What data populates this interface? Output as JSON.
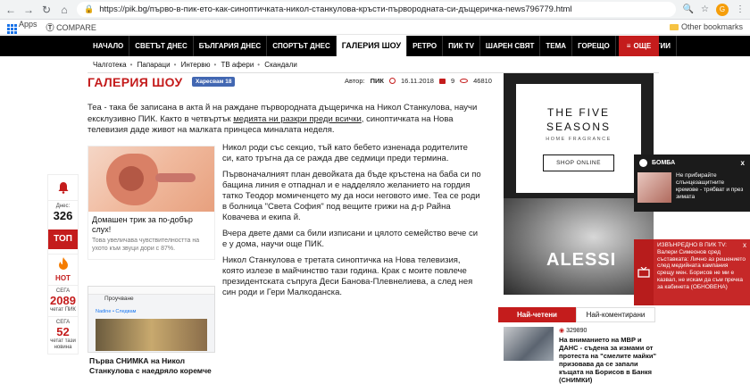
{
  "browser": {
    "url": "https://pik.bg/първо-в-пик-ето-как-синоптичката-никол-станкулова-кръсти-първородната-си-дъщеричка-news796779.html",
    "ext_badge": "G",
    "bookmarks": {
      "apps": "Apps",
      "compare": "COMPARE",
      "other": "Other bookmarks"
    }
  },
  "nav": {
    "items": [
      "НАЧАЛО",
      "СВЕТЪТ ДНЕС",
      "БЪЛГАРИЯ ДНЕС",
      "СПОРТЪТ ДНЕС",
      "ГАЛЕРИЯ ШОУ",
      "РЕТРО",
      "ПИК TV",
      "ШАРЕН СВЯТ",
      "ТЕМА",
      "ГОРЕЩО",
      "ТЕХНОЛОГИИ"
    ],
    "active": "ГАЛЕРИЯ ШОУ",
    "more": "ОЩЕ",
    "sub": [
      "Чалготека",
      "Папараци",
      "Интервю",
      "ТВ афери",
      "Скандали"
    ]
  },
  "article": {
    "section": "ГАЛЕРИЯ ШОУ",
    "like": "Харесвам 18",
    "author_label": "Автор:",
    "author": "ПИК",
    "date": "16.11.2018",
    "comments": "9",
    "views": "46810",
    "lead_a": "Теа - така бе записана в акта й на раждане първородната дъщеричка на Никол Станкулова, научи ексклузивно ПИК. Както в четвъртък ",
    "lead_u": "медията ни разкри преди всички",
    "lead_b": ", синоптичката на Нова телевизия даде живот на малката принцеса миналата неделя.",
    "p1": "Никол роди със секцио, тъй като бебето изненада родителите си, като тръгна да се ражда две седмици преди термина.",
    "p2": "Първоначалният план девойката да бъде кръстена на баба си по бащина линия е отпаднал и е надделяло желанието на гордия татко Теодор момиченцето му да носи неговото име. Теа се роди в болница \"Света София\" под вещите грижи на д-р Райна Ковачева и екипа й.",
    "p3": "Вчера двете дами са били изписани и цялото семейство вече си е у дома, научи още ПИК.",
    "p4": "Никол Станкулова е третата синоптичка на Нова телевизия, която излезе в майчинство тази година. Крак с моите повлече президентската съпруга Деси Банова-Плевнелиева, а след нея син роди и Гери Малкоданска."
  },
  "promo1": {
    "title": "Домашен трик за по-добър слух!",
    "desc": "Това увеличава чувствителността на ухото към звуци дори с 87%."
  },
  "promo2": {
    "header": "Проучване",
    "row": "Nadine • Следвам",
    "title": "Първа СНИМКА на Никол Станкулова с наедряло коремче"
  },
  "stats": {
    "today_label": "Днес:",
    "today": "326",
    "top": "ТОП",
    "hot": "HOT",
    "week_label": "СЕГА",
    "week": "2089",
    "week_sub": "четат ПИК",
    "news_label": "СЕГА",
    "news": "52",
    "news_sub": "четат тази новина"
  },
  "ad": {
    "brand1": "THE FIVE",
    "brand2": "SEASONS",
    "tag": "HOME FRAGRANCE",
    "shop": "SHOP ONLINE",
    "logo": "ALESSI"
  },
  "tabs": {
    "read": "Най-четени",
    "commented": "Най-коментирани"
  },
  "top_news": {
    "views": "329890",
    "title": "На вниманието на МВР и ДАНС - съдена за измами от протеста на \"смелите майки\" призовава да се запали къщата на Борисов в Банкя (СНИМКИ)"
  },
  "pop1": {
    "label": "БОМБА",
    "text": "Не прибирайте слънцезащитните кремове - трябват и през зимата",
    "close": "x"
  },
  "pop2": {
    "text": "ИЗВЪНРЕДНО В ПИК TV: Валери Симеонов сред съставката: Лично аз решението след медийната кампания срещу мен. Борисов не ми е казвал, не искам да съм пречка за кабинета (ОБНОВЕНА)",
    "close": "x"
  }
}
